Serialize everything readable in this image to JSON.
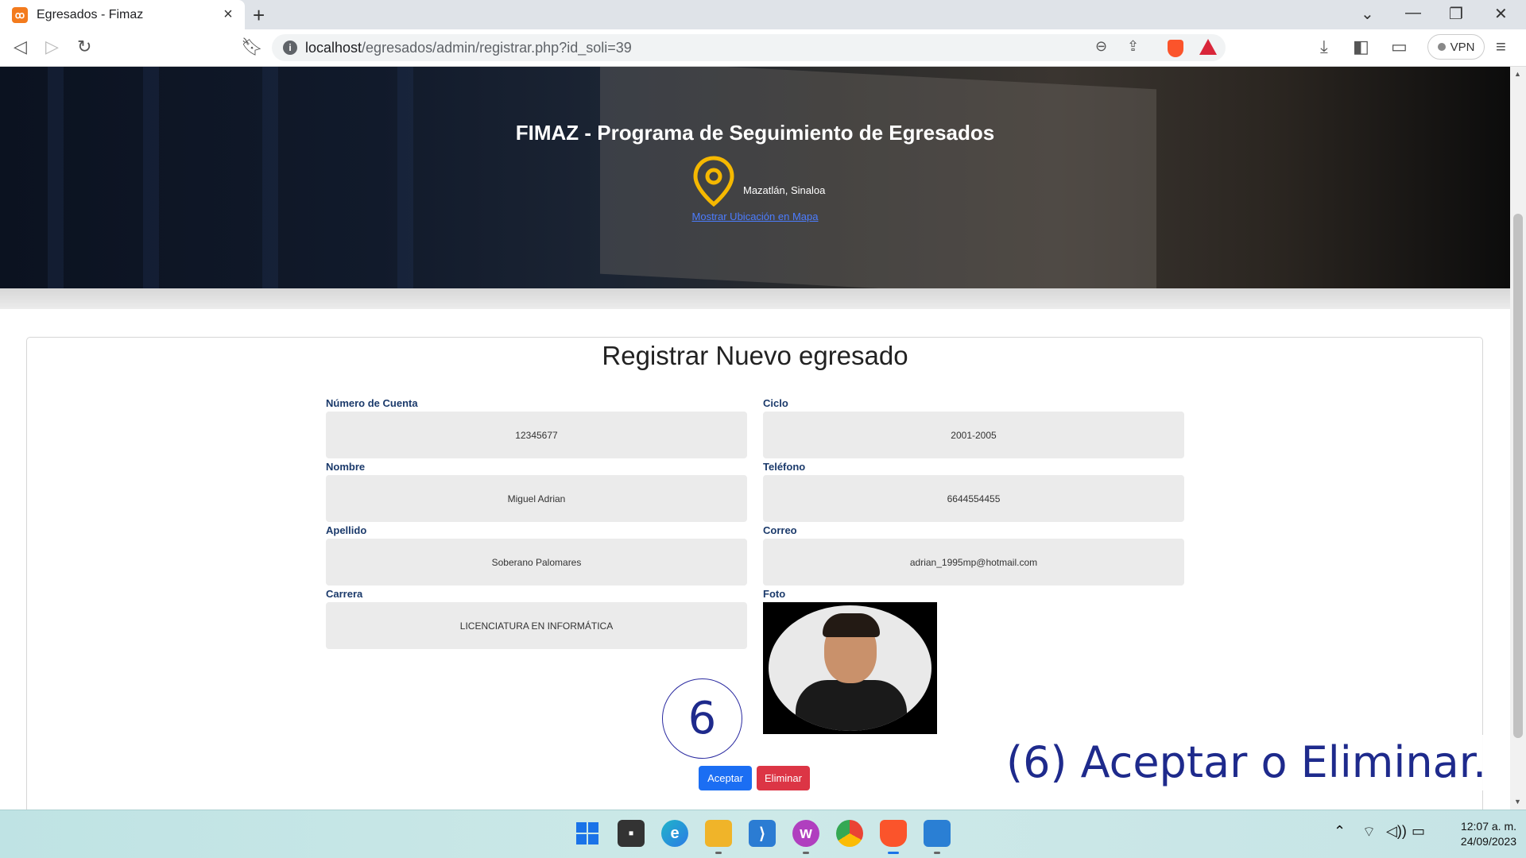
{
  "browser": {
    "tab_title": "Egresados - Fimaz",
    "tab_favicon": "xampp-icon",
    "url_host": "localhost",
    "url_path": "/egresados/admin/registrar.php?id_soli=39",
    "vpn_label": "VPN"
  },
  "hero": {
    "title": "FIMAZ - Programa de Seguimiento de Egresados",
    "location": "Mazatlán, Sinaloa",
    "map_link": "Mostrar Ubicación en Mapa"
  },
  "form": {
    "title": "Registrar Nuevo egresado",
    "fields": {
      "cuenta": {
        "label": "Número de Cuenta",
        "value": "12345677"
      },
      "ciclo": {
        "label": "Ciclo",
        "value": "2001-2005"
      },
      "nombre": {
        "label": "Nombre",
        "value": "Miguel Adrian"
      },
      "telefono": {
        "label": "Teléfono",
        "value": "6644554455"
      },
      "apellido": {
        "label": "Apellido",
        "value": "Soberano Palomares"
      },
      "correo": {
        "label": "Correo",
        "value": "adrian_1995mp@hotmail.com"
      },
      "carrera": {
        "label": "Carrera",
        "value": "LICENCIATURA EN INFORMÁTICA"
      },
      "foto": {
        "label": "Foto"
      }
    },
    "accept_label": "Aceptar",
    "delete_label": "Eliminar"
  },
  "annotation": {
    "step_number": "6",
    "caption": "(6) Aceptar o Eliminar."
  },
  "taskbar": {
    "time": "12:07 a. m.",
    "date": "24/09/2023"
  },
  "colors": {
    "accept": "#1b6ef3",
    "delete": "#dc3545",
    "label": "#1b3a6b",
    "pin": "#f5b800",
    "annotation": "#1e2a8c"
  }
}
